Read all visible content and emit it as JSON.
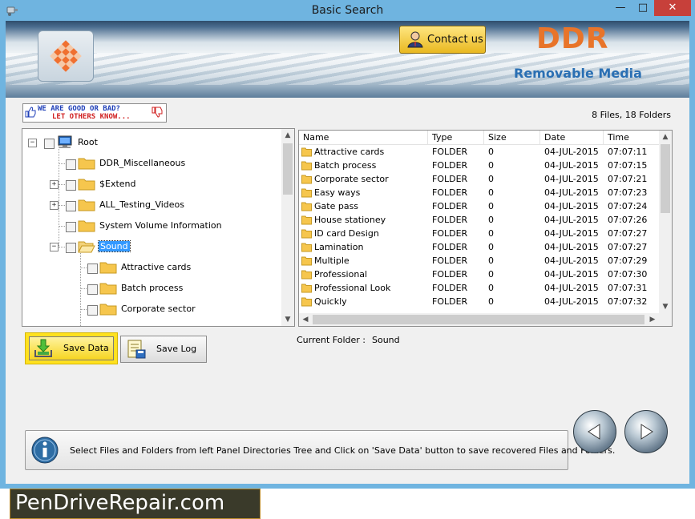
{
  "window": {
    "title": "Basic Search",
    "minimize": "—",
    "maximize": "□",
    "close": "✕"
  },
  "banner": {
    "contact_label": "Contact us",
    "brand": "DDR",
    "brand_sub": "Removable Media",
    "brand_color": "#e8742a"
  },
  "feedback": {
    "line1": "WE ARE GOOD OR BAD?",
    "line2": "LET OTHERS KNOW..."
  },
  "counts": "8 Files, 18 Folders",
  "tree": {
    "nodes": [
      {
        "label": "Root",
        "expander": "−",
        "icon": "computer-icon"
      },
      {
        "label": "DDR_Miscellaneous",
        "expander": "",
        "icon": "folder-icon"
      },
      {
        "label": "$Extend",
        "expander": "+",
        "icon": "folder-icon"
      },
      {
        "label": "ALL_Testing_Videos",
        "expander": "+",
        "icon": "folder-icon"
      },
      {
        "label": "System Volume Information",
        "expander": "",
        "icon": "folder-icon"
      },
      {
        "label": "Sound",
        "expander": "−",
        "icon": "open-folder-icon",
        "selected": true
      },
      {
        "label": "Attractive cards",
        "expander": "",
        "icon": "folder-icon"
      },
      {
        "label": "Batch process",
        "expander": "",
        "icon": "folder-icon"
      },
      {
        "label": "Corporate sector",
        "expander": "",
        "icon": "folder-icon"
      }
    ]
  },
  "list": {
    "columns": [
      "Name",
      "Type",
      "Size",
      "Date",
      "Time"
    ],
    "rows": [
      [
        "Attractive cards",
        "FOLDER",
        "0",
        "04-JUL-2015",
        "07:07:11"
      ],
      [
        "Batch process",
        "FOLDER",
        "0",
        "04-JUL-2015",
        "07:07:15"
      ],
      [
        "Corporate sector",
        "FOLDER",
        "0",
        "04-JUL-2015",
        "07:07:21"
      ],
      [
        "Easy ways",
        "FOLDER",
        "0",
        "04-JUL-2015",
        "07:07:23"
      ],
      [
        "Gate pass",
        "FOLDER",
        "0",
        "04-JUL-2015",
        "07:07:24"
      ],
      [
        "House stationey",
        "FOLDER",
        "0",
        "04-JUL-2015",
        "07:07:26"
      ],
      [
        "ID card Design",
        "FOLDER",
        "0",
        "04-JUL-2015",
        "07:07:27"
      ],
      [
        "Lamination",
        "FOLDER",
        "0",
        "04-JUL-2015",
        "07:07:27"
      ],
      [
        "Multiple",
        "FOLDER",
        "0",
        "04-JUL-2015",
        "07:07:29"
      ],
      [
        "Professional",
        "FOLDER",
        "0",
        "04-JUL-2015",
        "07:07:30"
      ],
      [
        "Professional Look",
        "FOLDER",
        "0",
        "04-JUL-2015",
        "07:07:31"
      ],
      [
        "Quickly",
        "FOLDER",
        "0",
        "04-JUL-2015",
        "07:07:32"
      ]
    ]
  },
  "buttons": {
    "save_data": "Save Data",
    "save_log": "Save Log"
  },
  "current_folder": {
    "label": "Current Folder :",
    "value": "Sound"
  },
  "status": {
    "message": "Select Files and Folders from left Panel Directories Tree and Click on 'Save Data' button to save recovered Files and Folders."
  },
  "watermark": "PenDriveRepair.com"
}
